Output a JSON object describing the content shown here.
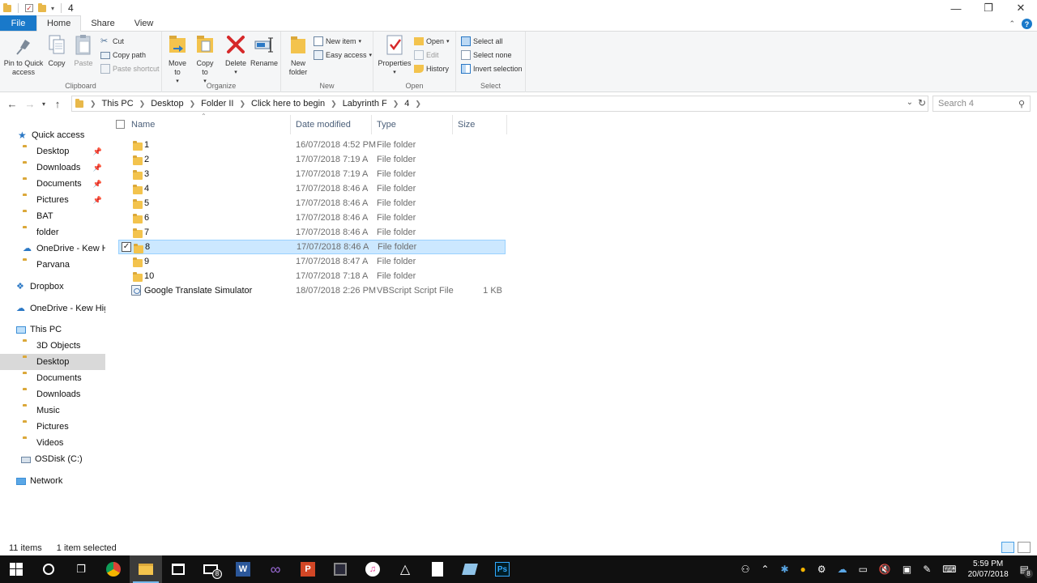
{
  "window": {
    "title": "4"
  },
  "tabs": [
    {
      "label": "File"
    },
    {
      "label": "Home"
    },
    {
      "label": "Share"
    },
    {
      "label": "View"
    }
  ],
  "ribbon": {
    "clipboard": {
      "label": "Clipboard",
      "pin": "Pin to Quick access",
      "copy": "Copy",
      "paste": "Paste",
      "cut": "Cut",
      "copy_path": "Copy path",
      "paste_shortcut": "Paste shortcut"
    },
    "organize": {
      "label": "Organize",
      "move_to": "Move to",
      "copy_to": "Copy to",
      "delete": "Delete",
      "rename": "Rename"
    },
    "new": {
      "label": "New",
      "new_folder": "New folder",
      "new_item": "New item",
      "easy_access": "Easy access"
    },
    "open": {
      "label": "Open",
      "properties": "Properties",
      "open": "Open",
      "edit": "Edit",
      "history": "History"
    },
    "select": {
      "label": "Select",
      "select_all": "Select all",
      "select_none": "Select none",
      "invert": "Invert selection"
    }
  },
  "address": {
    "crumbs": [
      "This PC",
      "Desktop",
      "Folder II",
      "Click here to begin",
      "Labyrinth F",
      "4"
    ],
    "search_placeholder": "Search 4"
  },
  "nav": {
    "quick_access": "Quick access",
    "quick_items": [
      {
        "label": "Desktop",
        "pinned": true
      },
      {
        "label": "Downloads",
        "pinned": true
      },
      {
        "label": "Documents",
        "pinned": true
      },
      {
        "label": "Pictures",
        "pinned": true
      },
      {
        "label": "BAT",
        "pinned": false
      },
      {
        "label": "folder",
        "pinned": false
      },
      {
        "label": "OneDrive - Kew Hig",
        "pinned": false
      },
      {
        "label": "Parvana",
        "pinned": false
      }
    ],
    "dropbox": "Dropbox",
    "onedrive": "OneDrive - Kew High",
    "this_pc": "This PC",
    "pc_items": [
      {
        "label": "3D Objects"
      },
      {
        "label": "Desktop"
      },
      {
        "label": "Documents"
      },
      {
        "label": "Downloads"
      },
      {
        "label": "Music"
      },
      {
        "label": "Pictures"
      },
      {
        "label": "Videos"
      },
      {
        "label": "OSDisk (C:)"
      }
    ],
    "network": "Network"
  },
  "columns": {
    "name": "Name",
    "date": "Date modified",
    "type": "Type",
    "size": "Size"
  },
  "files": [
    {
      "name": "1",
      "date": "16/07/2018 4:52 PM",
      "type": "File folder",
      "size": ""
    },
    {
      "name": "2",
      "date": "17/07/2018 7:19 A",
      "type": "File folder",
      "size": ""
    },
    {
      "name": "3",
      "date": "17/07/2018 7:19 A",
      "type": "File folder",
      "size": ""
    },
    {
      "name": "4",
      "date": "17/07/2018 8:46 A",
      "type": "File folder",
      "size": ""
    },
    {
      "name": "5",
      "date": "17/07/2018 8:46 A",
      "type": "File folder",
      "size": ""
    },
    {
      "name": "6",
      "date": "17/07/2018 8:46 A",
      "type": "File folder",
      "size": ""
    },
    {
      "name": "7",
      "date": "17/07/2018 8:46 A",
      "type": "File folder",
      "size": ""
    },
    {
      "name": "8",
      "date": "17/07/2018 8:46 A",
      "type": "File folder",
      "size": ""
    },
    {
      "name": "9",
      "date": "17/07/2018 8:47 A",
      "type": "File folder",
      "size": ""
    },
    {
      "name": "10",
      "date": "17/07/2018 7:18 A",
      "type": "File folder",
      "size": ""
    },
    {
      "name": "Google Translate Simulator",
      "date": "18/07/2018 2:26 PM",
      "type": "VBScript Script File",
      "size": "1 KB"
    }
  ],
  "status": {
    "count": "11 items",
    "selected": "1 item selected"
  },
  "taskbar": {
    "badge_mail": "8",
    "badge_notif": "8",
    "time": "5:59 PM",
    "date": "20/07/2018"
  },
  "colors": {
    "accent": "#1979ca",
    "selection": "#cce8ff",
    "folder": "#f3c34d",
    "taskbar": "#101010"
  }
}
